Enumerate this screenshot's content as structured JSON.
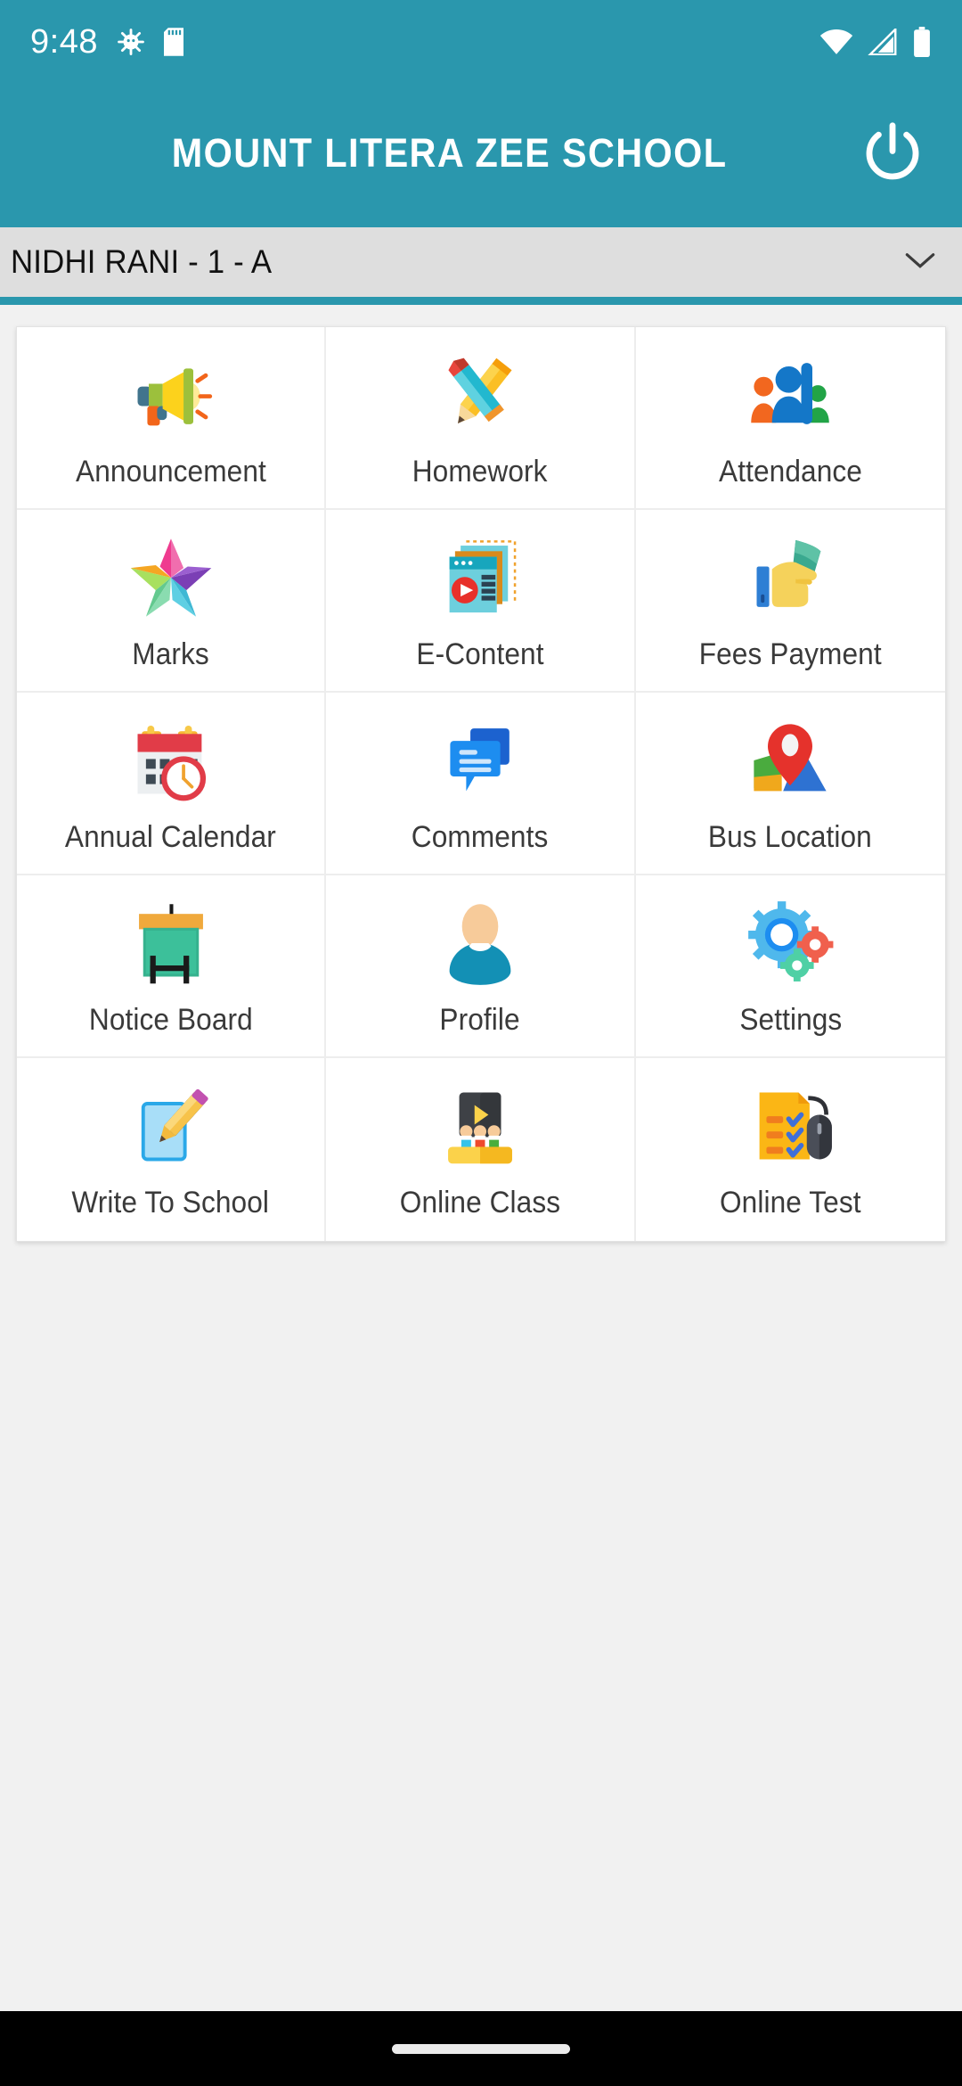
{
  "theme": {
    "primary": "#2a97ad",
    "selector_bg": "#dedede",
    "page_bg": "#f1f1f1",
    "tile_bg": "#ffffff",
    "label_color": "#3a3a3a",
    "navbar_bg": "#000000"
  },
  "status_bar": {
    "time": "9:48",
    "left_icons": [
      "android-bug-icon",
      "sd-card-icon"
    ],
    "right_icons": [
      "wifi-icon",
      "cellular-signal-icon",
      "battery-icon"
    ]
  },
  "app_bar": {
    "title": "MOUNT LITERA ZEE SCHOOL",
    "power_icon": "power-icon"
  },
  "selector": {
    "value": "NIDHI RANI - 1 - A",
    "caret_icon": "chevron-down-icon"
  },
  "grid": {
    "columns": 3,
    "tiles": [
      {
        "label": "Announcement",
        "icon": "megaphone-icon"
      },
      {
        "label": "Homework",
        "icon": "crossed-pencils-icon"
      },
      {
        "label": "Attendance",
        "icon": "people-group-icon"
      },
      {
        "label": "Marks",
        "icon": "star-icon"
      },
      {
        "label": "E-Content",
        "icon": "video-documents-icon"
      },
      {
        "label": "Fees Payment",
        "icon": "hand-money-card-icon"
      },
      {
        "label": "Annual Calendar",
        "icon": "calendar-clock-icon"
      },
      {
        "label": "Comments",
        "icon": "speech-bubbles-icon"
      },
      {
        "label": "Bus Location",
        "icon": "map-pin-icon"
      },
      {
        "label": "Notice Board",
        "icon": "easel-board-icon"
      },
      {
        "label": "Profile",
        "icon": "person-avatar-icon"
      },
      {
        "label": "Settings",
        "icon": "gears-icon"
      },
      {
        "label": "Write To School",
        "icon": "paper-pencil-icon"
      },
      {
        "label": "Online Class",
        "icon": "classroom-screen-icon"
      },
      {
        "label": "Online Test",
        "icon": "checklist-mouse-icon"
      }
    ]
  },
  "nav_bar": {
    "home_indicator": "home-indicator-pill"
  }
}
